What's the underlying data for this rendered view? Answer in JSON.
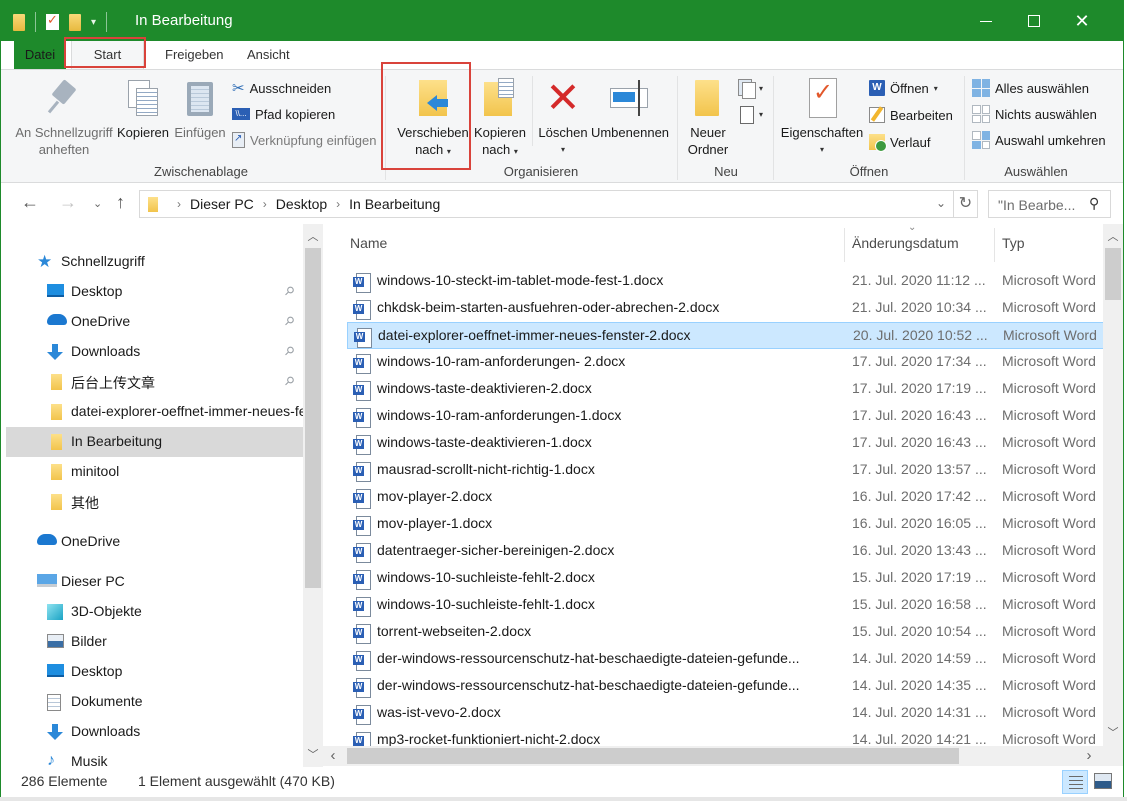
{
  "window": {
    "title": "In Bearbeitung",
    "accent_color": "#1e8a2b"
  },
  "titlebar": {
    "minimize_label": "Minimieren",
    "maximize_label": "Maximieren",
    "close_glyph": "✕",
    "qat_dropdown_glyph": "▾"
  },
  "ribbon_tabs": [
    {
      "label": "Datei"
    },
    {
      "label": "Start",
      "active": true
    },
    {
      "label": "Freigeben"
    },
    {
      "label": "Ansicht"
    }
  ],
  "ribbon_controls": {
    "collapse_glyph": "︿",
    "help_glyph": "?"
  },
  "ribbon": {
    "clipboard": {
      "group_label": "Zwischenablage",
      "pin_label_line1": "An Schnellzugriff",
      "pin_label_line2": "anheften",
      "copy_label": "Kopieren",
      "paste_label": "Einfügen",
      "cut_label": "Ausschneiden",
      "copy_path_label": "Pfad kopieren",
      "paste_shortcut_label": "Verknüpfung einfügen"
    },
    "organize": {
      "group_label": "Organisieren",
      "move_to_line1": "Verschieben",
      "move_to_line2": "nach",
      "copy_to_line1": "Kopieren",
      "copy_to_line2": "nach",
      "delete_label": "Löschen",
      "rename_label": "Umbenennen"
    },
    "new": {
      "group_label": "Neu",
      "new_folder_line1": "Neuer",
      "new_folder_line2": "Ordner"
    },
    "open": {
      "group_label": "Öffnen",
      "properties_label": "Eigenschaften",
      "open_label": "Öffnen",
      "edit_label": "Bearbeiten",
      "history_label": "Verlauf"
    },
    "select": {
      "group_label": "Auswählen",
      "select_all_label": "Alles auswählen",
      "select_none_label": "Nichts auswählen",
      "invert_label": "Auswahl umkehren"
    },
    "caret_glyph": "▾"
  },
  "navigation": {
    "back_glyph": "←",
    "forward_glyph": "→",
    "recent_glyph": "⌄",
    "up_glyph": "↑",
    "breadcrumb": [
      "Dieser PC",
      "Desktop",
      "In Bearbeitung"
    ],
    "crumb_sep": "›",
    "address_dropdown_glyph": "⌄",
    "refresh_glyph": "↻",
    "search_placeholder": "\"In Bearbe...",
    "search_glyph": "⚲"
  },
  "nav_pane": {
    "items": [
      {
        "label": "Schnellzugriff",
        "icon": "star-icon",
        "level": 0
      },
      {
        "label": "Desktop",
        "icon": "desktop-icon",
        "level": 1,
        "pinned": true
      },
      {
        "label": "OneDrive",
        "icon": "onedrive-icon",
        "level": 1,
        "pinned": true
      },
      {
        "label": "Downloads",
        "icon": "downloads-icon",
        "level": 1,
        "pinned": true
      },
      {
        "label": "后台上传文章",
        "icon": "folder-icon",
        "level": 1,
        "pinned": true
      },
      {
        "label": "datei-explorer-oeffnet-immer-neues-fenster",
        "icon": "folder-icon",
        "level": 1
      },
      {
        "label": "In Bearbeitung",
        "icon": "folder-icon",
        "level": 1,
        "selected": true
      },
      {
        "label": "minitool",
        "icon": "folder-icon",
        "level": 1
      },
      {
        "label": "其他",
        "icon": "folder-icon",
        "level": 1
      },
      {
        "label": "OneDrive",
        "icon": "onedrive-icon",
        "level": 0
      },
      {
        "label": "Dieser PC",
        "icon": "pc-icon",
        "level": 0
      },
      {
        "label": "3D-Objekte",
        "icon": "3d-objects-icon",
        "level": 1
      },
      {
        "label": "Bilder",
        "icon": "pictures-icon",
        "level": 1
      },
      {
        "label": "Desktop",
        "icon": "desktop-icon",
        "level": 1
      },
      {
        "label": "Dokumente",
        "icon": "documents-icon",
        "level": 1
      },
      {
        "label": "Downloads",
        "icon": "downloads-icon",
        "level": 1
      },
      {
        "label": "Musik",
        "icon": "music-icon",
        "level": 1
      }
    ],
    "pin_glyph": "📌"
  },
  "file_list": {
    "columns": {
      "name": "Name",
      "date": "Änderungsdatum",
      "type": "Typ"
    },
    "sort_glyph": "⌄",
    "rows": [
      {
        "name": "windows-10-steckt-im-tablet-mode-fest-1.docx",
        "date": "21. Jul. 2020 11:12 ...",
        "type": "Microsoft Word"
      },
      {
        "name": "chkdsk-beim-starten-ausfuehren-oder-abrechen-2.docx",
        "date": "21. Jul. 2020 10:34 ...",
        "type": "Microsoft Word"
      },
      {
        "name": "datei-explorer-oeffnet-immer-neues-fenster-2.docx",
        "date": "20. Jul. 2020 10:52 ...",
        "type": "Microsoft Word",
        "selected": true
      },
      {
        "name": "windows-10-ram-anforderungen- 2.docx",
        "date": "17. Jul. 2020 17:34 ...",
        "type": "Microsoft Word"
      },
      {
        "name": "windows-taste-deaktivieren-2.docx",
        "date": "17. Jul. 2020 17:19 ...",
        "type": "Microsoft Word"
      },
      {
        "name": "windows-10-ram-anforderungen-1.docx",
        "date": "17. Jul. 2020 16:43 ...",
        "type": "Microsoft Word"
      },
      {
        "name": "windows-taste-deaktivieren-1.docx",
        "date": "17. Jul. 2020 16:43 ...",
        "type": "Microsoft Word"
      },
      {
        "name": "mausrad-scrollt-nicht-richtig-1.docx",
        "date": "17. Jul. 2020 13:57 ...",
        "type": "Microsoft Word"
      },
      {
        "name": "mov-player-2.docx",
        "date": "16. Jul. 2020 17:42 ...",
        "type": "Microsoft Word"
      },
      {
        "name": "mov-player-1.docx",
        "date": "16. Jul. 2020 16:05 ...",
        "type": "Microsoft Word"
      },
      {
        "name": "datentraeger-sicher-bereinigen-2.docx",
        "date": "16. Jul. 2020 13:43 ...",
        "type": "Microsoft Word"
      },
      {
        "name": "windows-10-suchleiste-fehlt-2.docx",
        "date": "15. Jul. 2020 17:19 ...",
        "type": "Microsoft Word"
      },
      {
        "name": "windows-10-suchleiste-fehlt-1.docx",
        "date": "15. Jul. 2020 16:58 ...",
        "type": "Microsoft Word"
      },
      {
        "name": "torrent-webseiten-2.docx",
        "date": "15. Jul. 2020 10:54 ...",
        "type": "Microsoft Word"
      },
      {
        "name": "der-windows-ressourcenschutz-hat-beschaedigte-dateien-gefunde...",
        "date": "14. Jul. 2020 14:59 ...",
        "type": "Microsoft Word"
      },
      {
        "name": "der-windows-ressourcenschutz-hat-beschaedigte-dateien-gefunde...",
        "date": "14. Jul. 2020 14:35 ...",
        "type": "Microsoft Word"
      },
      {
        "name": "was-ist-vevo-2.docx",
        "date": "14. Jul. 2020 14:31 ...",
        "type": "Microsoft Word"
      },
      {
        "name": "mp3-rocket-funktioniert-nicht-2.docx",
        "date": "14. Jul. 2020 14:21 ...",
        "type": "Microsoft Word"
      }
    ]
  },
  "scrollbars": {
    "up_glyph": "︿",
    "down_glyph": "﹀",
    "left_glyph": "‹",
    "right_glyph": "›"
  },
  "statusbar": {
    "item_count": "286 Elemente",
    "selection": "1 Element ausgewählt (470 KB)"
  }
}
